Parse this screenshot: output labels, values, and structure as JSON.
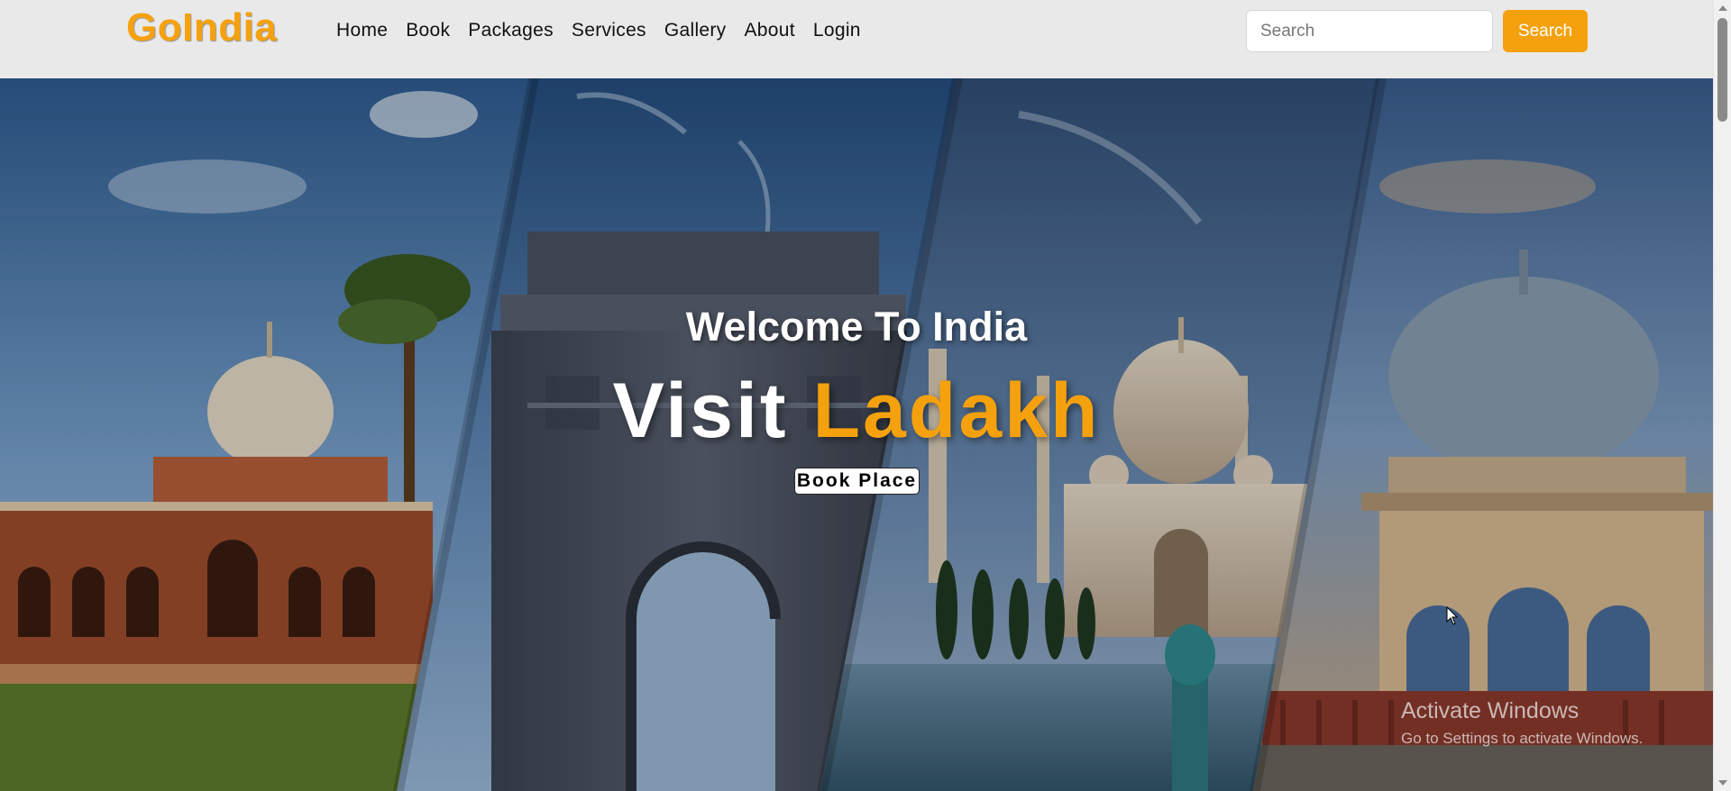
{
  "brand": {
    "name": "GoIndia",
    "color": "#f5a10e"
  },
  "nav": {
    "links": [
      "Home",
      "Book",
      "Packages",
      "Services",
      "Gallery",
      "About",
      "Login"
    ]
  },
  "search": {
    "placeholder": "Search",
    "value": "",
    "button_label": "Search"
  },
  "hero": {
    "welcome": "Welcome To India",
    "visit_prefix": "Visit",
    "visit_place": "Ladakh",
    "book_button": "Book Place",
    "images": [
      "humayun-tomb",
      "india-gate",
      "taj-mahal",
      "rajasthan-chhatri"
    ]
  },
  "watermark": {
    "line1": "Activate Windows",
    "line2": "Go to Settings to activate Windows."
  },
  "colors": {
    "accent": "#f5a10e",
    "navbar_bg": "#e9e9e9"
  }
}
